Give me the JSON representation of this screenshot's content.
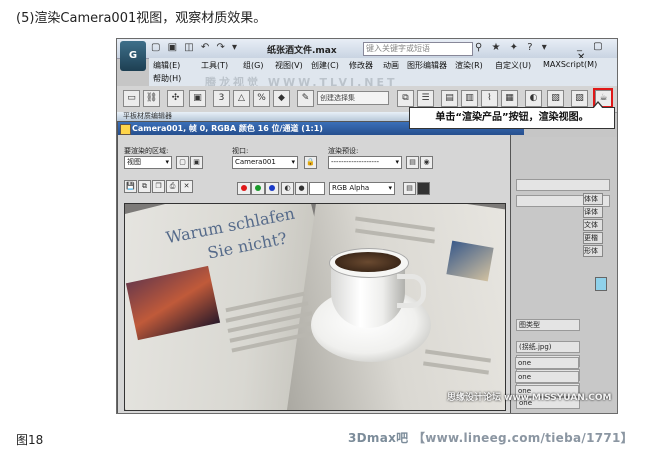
{
  "step_title": "(5)渲染Camera001视图，观察材质效果。",
  "figure_label": "图18",
  "footer_watermark": {
    "brand": "3Dmax吧",
    "url": "【www.lineeg.com/tieba/1771】"
  },
  "image_watermark": "思缘设计论坛 www.MISSYUAN.COM",
  "app": {
    "logo_text": "G",
    "doc_title": "纸张酒文件.max",
    "search_placeholder": "键入关键字或短语",
    "menu": [
      "编辑(E)",
      "工具(T)",
      "组(G)",
      "视图(V)",
      "创建(C)",
      "修改器",
      "动画",
      "图形编辑器",
      "渲染(R)",
      "自定义(U)",
      "MAXScript(M)",
      "帮助(H)"
    ],
    "menu_watermark": "腾龙视觉 WWW.TLVI.NET",
    "selection_set_placeholder": "创建选择集"
  },
  "callout_text": "单击“渲染产品”按钮，渲染视图。",
  "material_editor_title": "平板材质编辑器",
  "frame_buffer": {
    "title": "Camera001, 帧 0, RGBA 颜色 16 位/通道 (1:1)",
    "area_label": "要渲染的区域:",
    "area_value": "视图",
    "viewport_label": "视口:",
    "viewport_value": "Camera001",
    "preset_label": "渲染预设:",
    "preset_value": "-------------------",
    "channel_value": "RGB Alpha"
  },
  "render_image": {
    "headline_line1": "Warum schlafen",
    "headline_line2": "Sie nicht?"
  },
  "side_panel": {
    "rows": [
      "图类型",
      "(拐纸.jpg)",
      "one",
      "one",
      "one",
      "one",
      "one",
      "one",
      "one"
    ],
    "buttons": [
      "体体",
      "译体",
      "文体",
      "更楷",
      "形体"
    ]
  },
  "colors": {
    "accent_red": "#e01818",
    "title_blue": "#264f8e",
    "swatch_cyan": "#8fd1ea"
  }
}
